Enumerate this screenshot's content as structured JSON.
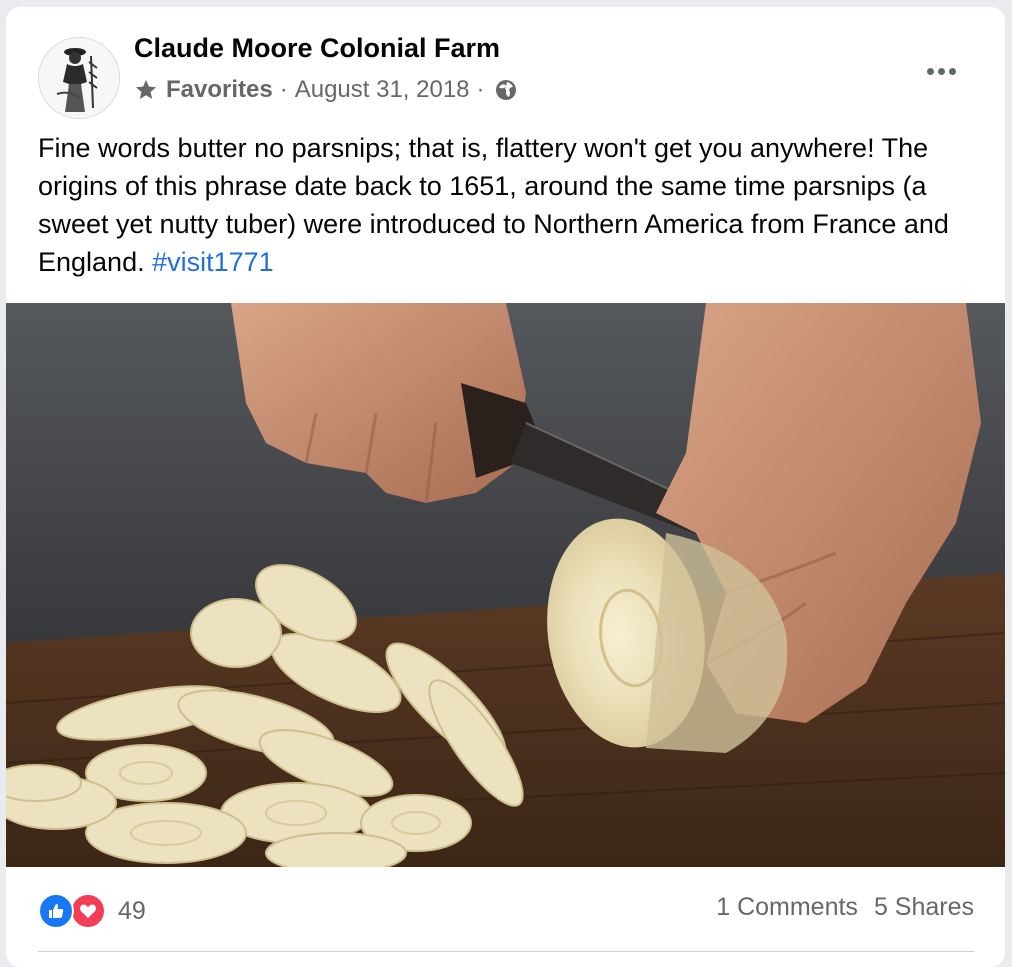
{
  "post": {
    "author": "Claude Moore Colonial Farm",
    "audience_label": "Favorites",
    "separator": "·",
    "date": "August 31, 2018",
    "text": "Fine words butter no parsnips; that is, flattery won't get you anywhere! The origins of this phrase date back to 1651, around the same time parsnips (a sweet yet nutty tuber) were introduced to Northern America from France and England. ",
    "hashtag": "#visit1771"
  },
  "footer": {
    "reaction_count": "49",
    "comments": "1 Comments",
    "shares": "5 Shares"
  },
  "icons": {
    "audience": "star-icon",
    "privacy": "globe-icon",
    "menu": "more-options-icon",
    "reactions": [
      "like-icon",
      "love-icon"
    ]
  },
  "colors": {
    "hashtag": "#216fdb",
    "like": "#1877f2",
    "love": "#f33e58",
    "meta": "#65676b"
  }
}
